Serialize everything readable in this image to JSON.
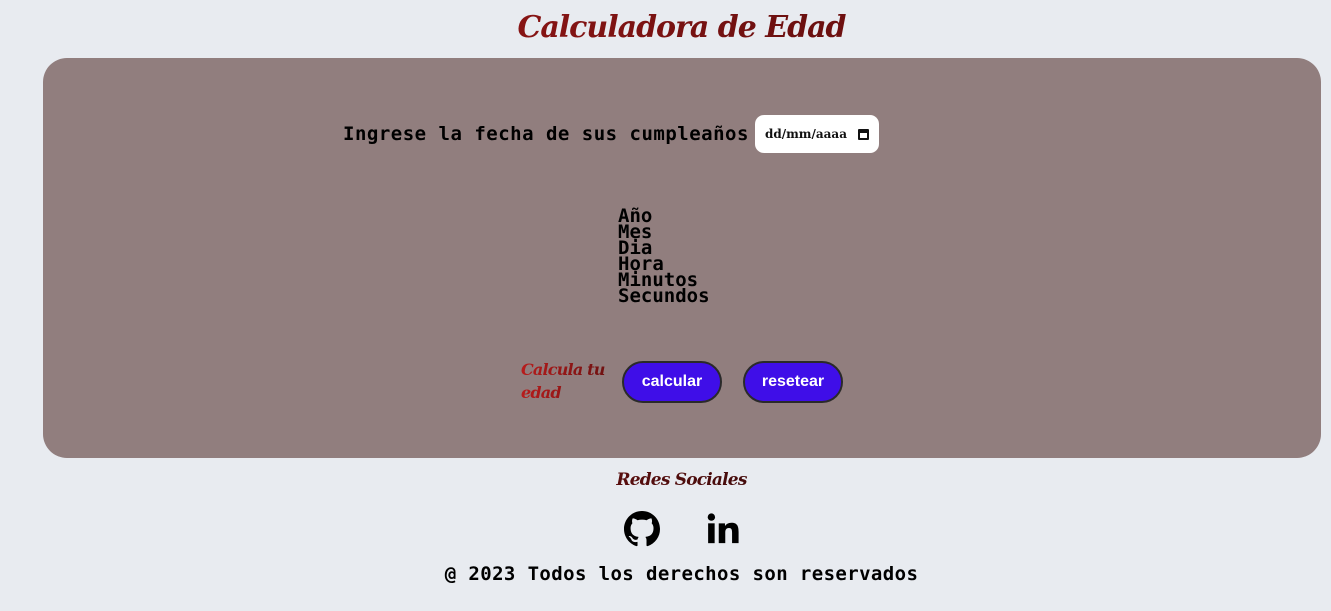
{
  "header": {
    "title": "Calculadora de Edad"
  },
  "form": {
    "date_label": "Ingrese la fecha de sus cumpleaños",
    "date_placeholder": "dd/mm/aaaa"
  },
  "results": {
    "items": [
      "Año",
      "Mes",
      "Dia",
      "Hora",
      "Minutos",
      "Secundos"
    ]
  },
  "actions": {
    "prompt": "Calcula tu edad",
    "calculate_label": "calcular",
    "reset_label": "resetear"
  },
  "social": {
    "title": "Redes Sociales",
    "links": [
      {
        "icon": "github-icon"
      },
      {
        "icon": "linkedin-icon"
      }
    ]
  },
  "footer": {
    "text": "@ 2023 Todos los derechos son reservados"
  },
  "colors": {
    "background": "#e8ebf0",
    "card": "#917e7e",
    "button": "#3f0ee8",
    "title_red": "#b81c1c"
  }
}
